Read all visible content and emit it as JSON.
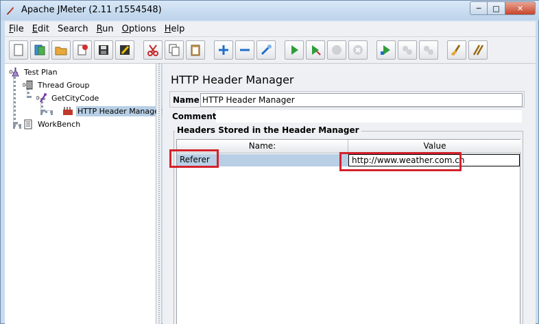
{
  "window": {
    "title": "Apache JMeter (2.11 r1554548)",
    "controls": {
      "minimize": "─",
      "maximize": "□",
      "close": "✕"
    }
  },
  "menubar": {
    "items": [
      {
        "mnemonic": "F",
        "rest": "ile"
      },
      {
        "mnemonic": "E",
        "rest": "dit"
      },
      {
        "mnemonic": "",
        "rest": "Search"
      },
      {
        "mnemonic": "R",
        "rest": "un"
      },
      {
        "mnemonic": "O",
        "rest": "ptions"
      },
      {
        "mnemonic": "H",
        "rest": "elp"
      }
    ]
  },
  "toolbar": {
    "buttons": [
      "new-icon",
      "templates-icon",
      "open-icon",
      "close-icon",
      "save-icon",
      "save-as-icon",
      "cut-icon",
      "copy-icon",
      "paste-icon",
      "expand-icon",
      "collapse-icon",
      "toggle-icon",
      "start-icon",
      "start-no-pause-icon",
      "stop-icon",
      "shutdown-icon",
      "remote-start-icon",
      "remote-stop-icon",
      "remote-shutdown-icon",
      "clear-icon",
      "clear-all-icon"
    ]
  },
  "tree": {
    "nodes": [
      {
        "label": "Test Plan"
      },
      {
        "label": "Thread Group"
      },
      {
        "label": "GetCityCode"
      },
      {
        "label": "HTTP Header Manager",
        "selected": true
      },
      {
        "label": "WorkBench"
      }
    ]
  },
  "panel": {
    "title": "HTTP Header Manager",
    "name_label": "Name:",
    "name_value": "HTTP Header Manager",
    "comments_label": "Comments:",
    "comments_value": "",
    "group_title": "Headers Stored in the Header Manager",
    "table": {
      "headers": {
        "name": "Name:",
        "value": "Value"
      },
      "rows": [
        {
          "name": "Referer",
          "value": "http://www.weather.com.cn"
        }
      ]
    }
  },
  "colors": {
    "highlight": "#d4222c",
    "selection": "#b8cfe5"
  }
}
